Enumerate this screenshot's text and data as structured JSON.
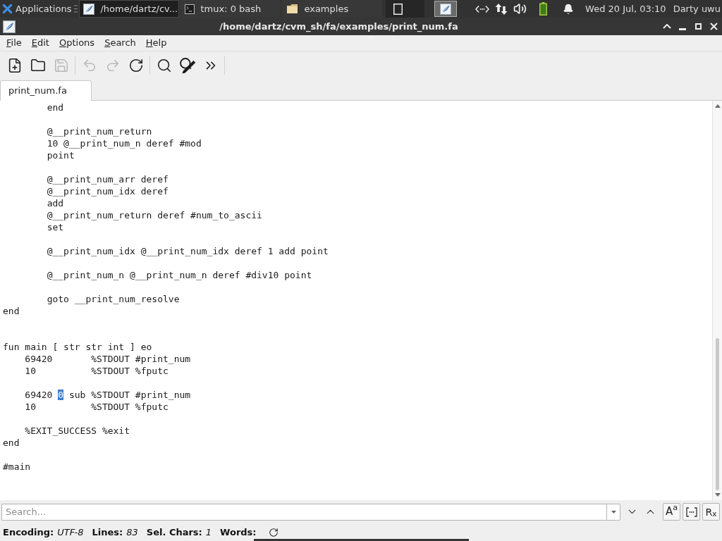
{
  "panel": {
    "menu_label": "Applications",
    "tasks": [
      {
        "title": "/home/dartz/cv...",
        "kind": "editor",
        "selected": true
      },
      {
        "title": "tmux: 0 bash",
        "kind": "terminal",
        "selected": false
      },
      {
        "title": "examples",
        "kind": "folder",
        "selected": false
      }
    ],
    "workspaces": [
      {
        "kind": "empty",
        "selected": false
      },
      {
        "kind": "editor",
        "selected": true
      }
    ],
    "clock": "Wed 20 Jul, 03:10",
    "user": "Darty uwu"
  },
  "window": {
    "title": "/home/dartz/cvm_sh/fa/examples/print_num.fa"
  },
  "menu": [
    "File",
    "Edit",
    "Options",
    "Search",
    "Help"
  ],
  "toolbar": [
    {
      "kind": "new",
      "disabled": false
    },
    {
      "kind": "open",
      "disabled": false
    },
    {
      "kind": "save",
      "disabled": true
    },
    {
      "kind": "separator"
    },
    {
      "kind": "undo",
      "disabled": true
    },
    {
      "kind": "redo",
      "disabled": true
    },
    {
      "kind": "reload",
      "disabled": false
    },
    {
      "kind": "separator"
    },
    {
      "kind": "find",
      "disabled": false
    },
    {
      "kind": "replace",
      "disabled": false
    },
    {
      "kind": "goto",
      "disabled": false
    },
    {
      "kind": "separator"
    }
  ],
  "tabs": [
    {
      "label": "print_num.fa",
      "selected": true
    }
  ],
  "editor": {
    "lines": [
      {
        "kind": "code",
        "text": "        end"
      },
      {
        "kind": "blank"
      },
      {
        "kind": "code",
        "text": "        @__print_num_return"
      },
      {
        "kind": "code",
        "text": "        10 @__print_num_n deref #mod"
      },
      {
        "kind": "code",
        "text": "        point"
      },
      {
        "kind": "blank"
      },
      {
        "kind": "code",
        "text": "        @__print_num_arr deref"
      },
      {
        "kind": "code",
        "text": "        @__print_num_idx deref"
      },
      {
        "kind": "code",
        "text": "        add"
      },
      {
        "kind": "code",
        "text": "        @__print_num_return deref #num_to_ascii"
      },
      {
        "kind": "code",
        "text": "        set"
      },
      {
        "kind": "blank"
      },
      {
        "kind": "code",
        "text": "        @__print_num_idx @__print_num_idx deref 1 add point"
      },
      {
        "kind": "blank"
      },
      {
        "kind": "code",
        "text": "        @__print_num_n @__print_num_n deref #div10 point"
      },
      {
        "kind": "blank"
      },
      {
        "kind": "code",
        "text": "        goto __print_num_resolve"
      },
      {
        "kind": "code",
        "text": "end"
      },
      {
        "kind": "blank"
      },
      {
        "kind": "blank"
      },
      {
        "kind": "code",
        "text": "fun main [ str str int ] eo"
      },
      {
        "kind": "code",
        "text": "    69420       %STDOUT #print_num"
      },
      {
        "kind": "code",
        "text": "    10          %STDOUT %fputc"
      },
      {
        "kind": "blank"
      },
      {
        "kind": "selection",
        "segments": [
          {
            "text": "    69420 ",
            "selected": false
          },
          {
            "text": "0",
            "selected": true
          },
          {
            "text": " sub %STDOUT #print_num",
            "selected": false
          }
        ]
      },
      {
        "kind": "code",
        "text": "    10          %STDOUT %fputc"
      },
      {
        "kind": "blank"
      },
      {
        "kind": "code",
        "text": "    %EXIT_SUCCESS %exit"
      },
      {
        "kind": "code",
        "text": "end"
      },
      {
        "kind": "blank"
      },
      {
        "kind": "code",
        "text": "#main"
      }
    ]
  },
  "search": {
    "placeholder": "Search...",
    "buttons": [
      {
        "kind": "next"
      },
      {
        "kind": "previous"
      },
      {
        "kind": "match_case",
        "label": "A$^{a}$"
      },
      {
        "kind": "whole_word"
      },
      {
        "kind": "regex",
        "label": "R$_{x}$"
      }
    ]
  },
  "status_bar": [
    {
      "label": "Encoding:",
      "value": "UTF-8"
    },
    {
      "label": "Lines:",
      "value": "83"
    },
    {
      "label": "Sel. Chars:",
      "value": "1"
    },
    {
      "label": "Words:",
      "kind": "refresh"
    }
  ]
}
